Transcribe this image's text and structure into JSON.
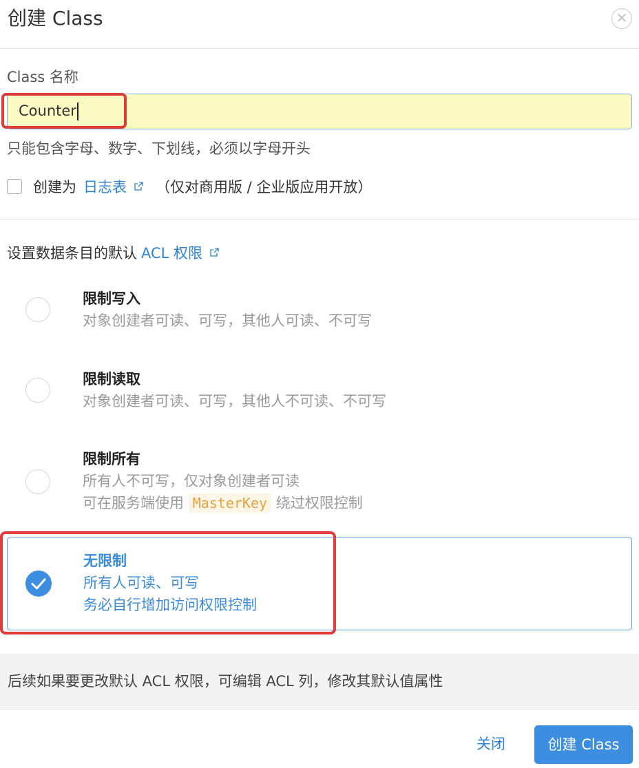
{
  "dialog": {
    "title": "创建 Class",
    "close_icon": "close-circle-icon"
  },
  "class_name": {
    "label": "Class 名称",
    "value": "Counter",
    "hint": "只能包含字母、数字、下划线，必须以字母开头"
  },
  "log_table": {
    "prefix": "创建为",
    "link_text": "日志表",
    "link_icon": "external-link-icon",
    "note": "（仅对商用版 / 企业版应用开放）",
    "checked": false
  },
  "acl": {
    "heading_prefix": "设置数据条目的默认",
    "heading_link": "ACL 权限",
    "heading_icon": "external-link-icon",
    "options": [
      {
        "title": "限制写入",
        "line1": "对象创建者可读、可写，其他人可读、不可写",
        "selected": false
      },
      {
        "title": "限制读取",
        "line1": "对象创建者可读、可写，其他人不可读、不可写",
        "selected": false
      },
      {
        "title": "限制所有",
        "line1": "所有人不可写，仅对象创建者可读",
        "line2_prefix": "可在服务端使用",
        "line2_code": "MasterKey",
        "line2_suffix": "绕过权限控制",
        "selected": false
      },
      {
        "title": "无限制",
        "line1": "所有人可读、可写",
        "line2": "务必自行增加访问权限控制",
        "selected": true
      }
    ]
  },
  "footnote": "后续如果要更改默认 ACL 权限，可编辑 ACL 列，修改其默认值属性",
  "buttons": {
    "close_label": "关闭",
    "create_label": "创建 Class"
  },
  "colors": {
    "accent": "#3d8de0",
    "link": "#2e83d6",
    "input_bg": "#fbfbc3",
    "annotation_red": "#e23b3b",
    "code_text": "#e6a23c"
  }
}
